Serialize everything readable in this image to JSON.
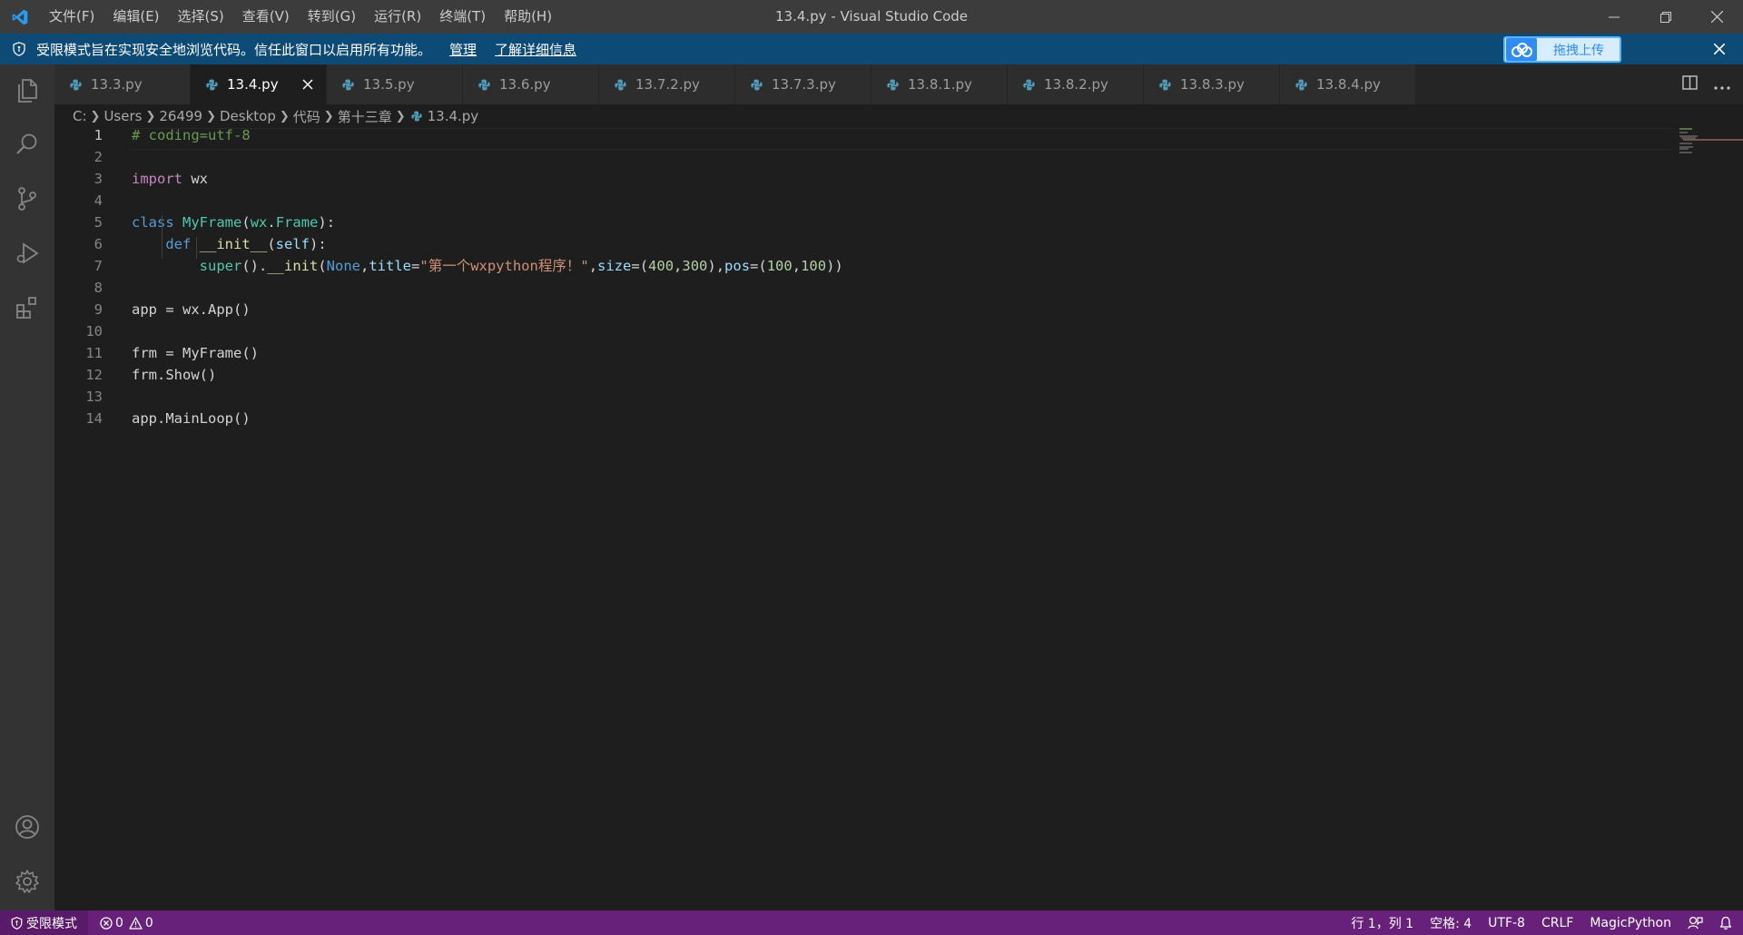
{
  "titlebar": {
    "menu": [
      "文件(F)",
      "编辑(E)",
      "选择(S)",
      "查看(V)",
      "转到(G)",
      "运行(R)",
      "终端(T)",
      "帮助(H)"
    ],
    "window_title": "13.4.py - Visual Studio Code"
  },
  "banner": {
    "message": "受限模式旨在实现安全地浏览代码。信任此窗口以启用所有功能。",
    "manage_link": "管理",
    "learn_more_link": "了解详细信息",
    "upload_button": "拖拽上传"
  },
  "tabs": [
    {
      "label": "13.3.py",
      "active": false
    },
    {
      "label": "13.4.py",
      "active": true
    },
    {
      "label": "13.5.py",
      "active": false
    },
    {
      "label": "13.6.py",
      "active": false
    },
    {
      "label": "13.7.2.py",
      "active": false
    },
    {
      "label": "13.7.3.py",
      "active": false
    },
    {
      "label": "13.8.1.py",
      "active": false
    },
    {
      "label": "13.8.2.py",
      "active": false
    },
    {
      "label": "13.8.3.py",
      "active": false
    },
    {
      "label": "13.8.4.py",
      "active": false
    }
  ],
  "breadcrumb": [
    "C:",
    "Users",
    "26499",
    "Desktop",
    "代码",
    "第十三章",
    "13.4.py"
  ],
  "editor": {
    "line_numbers": [
      "1",
      "2",
      "3",
      "4",
      "5",
      "6",
      "7",
      "8",
      "9",
      "10",
      "11",
      "12",
      "13",
      "14"
    ],
    "lines": [
      [
        {
          "t": "# coding=utf-8",
          "c": "cm"
        }
      ],
      [],
      [
        {
          "t": "import",
          "c": "kc"
        },
        {
          "t": " wx",
          "c": ""
        }
      ],
      [],
      [
        {
          "t": "class",
          "c": "k"
        },
        {
          "t": " ",
          "c": ""
        },
        {
          "t": "MyFrame",
          "c": "cls"
        },
        {
          "t": "(",
          "c": ""
        },
        {
          "t": "wx",
          "c": "cls"
        },
        {
          "t": ".",
          "c": ""
        },
        {
          "t": "Frame",
          "c": "cls"
        },
        {
          "t": "):",
          "c": ""
        }
      ],
      [
        {
          "t": "    ",
          "c": ""
        },
        {
          "t": "def",
          "c": "k"
        },
        {
          "t": " ",
          "c": ""
        },
        {
          "t": "__init__",
          "c": "fn"
        },
        {
          "t": "(",
          "c": ""
        },
        {
          "t": "self",
          "c": "prm"
        },
        {
          "t": "):",
          "c": ""
        }
      ],
      [
        {
          "t": "        ",
          "c": ""
        },
        {
          "t": "super",
          "c": "cls"
        },
        {
          "t": "().",
          "c": ""
        },
        {
          "t": "__init",
          "c": "fn"
        },
        {
          "t": "(",
          "c": ""
        },
        {
          "t": "None",
          "c": "k"
        },
        {
          "t": ",",
          "c": ""
        },
        {
          "t": "title",
          "c": "prm"
        },
        {
          "t": "=",
          "c": ""
        },
        {
          "t": "\"第一个wxpython程序！\"",
          "c": "str"
        },
        {
          "t": ",",
          "c": ""
        },
        {
          "t": "size",
          "c": "prm"
        },
        {
          "t": "=(",
          "c": ""
        },
        {
          "t": "400",
          "c": "num"
        },
        {
          "t": ",",
          "c": ""
        },
        {
          "t": "300",
          "c": "num"
        },
        {
          "t": "),",
          "c": ""
        },
        {
          "t": "pos",
          "c": "prm"
        },
        {
          "t": "=(",
          "c": ""
        },
        {
          "t": "100",
          "c": "num"
        },
        {
          "t": ",",
          "c": ""
        },
        {
          "t": "100",
          "c": "num"
        },
        {
          "t": "))",
          "c": ""
        }
      ],
      [],
      [
        {
          "t": "app = wx.App()",
          "c": ""
        }
      ],
      [],
      [
        {
          "t": "frm = MyFrame()",
          "c": ""
        }
      ],
      [
        {
          "t": "frm.Show()",
          "c": ""
        }
      ],
      [],
      [
        {
          "t": "app.MainLoop()",
          "c": ""
        }
      ]
    ]
  },
  "statusbar": {
    "restricted_mode": "受限模式",
    "errors": "0",
    "warnings": "0",
    "cursor_position": "行 1，列 1",
    "indentation": "空格: 4",
    "encoding": "UTF-8",
    "line_ending": "CRLF",
    "language": "MagicPython"
  },
  "colors": {
    "statusbar": "#68217a",
    "banner": "#0e4a76",
    "python_icon": "#519aba"
  }
}
